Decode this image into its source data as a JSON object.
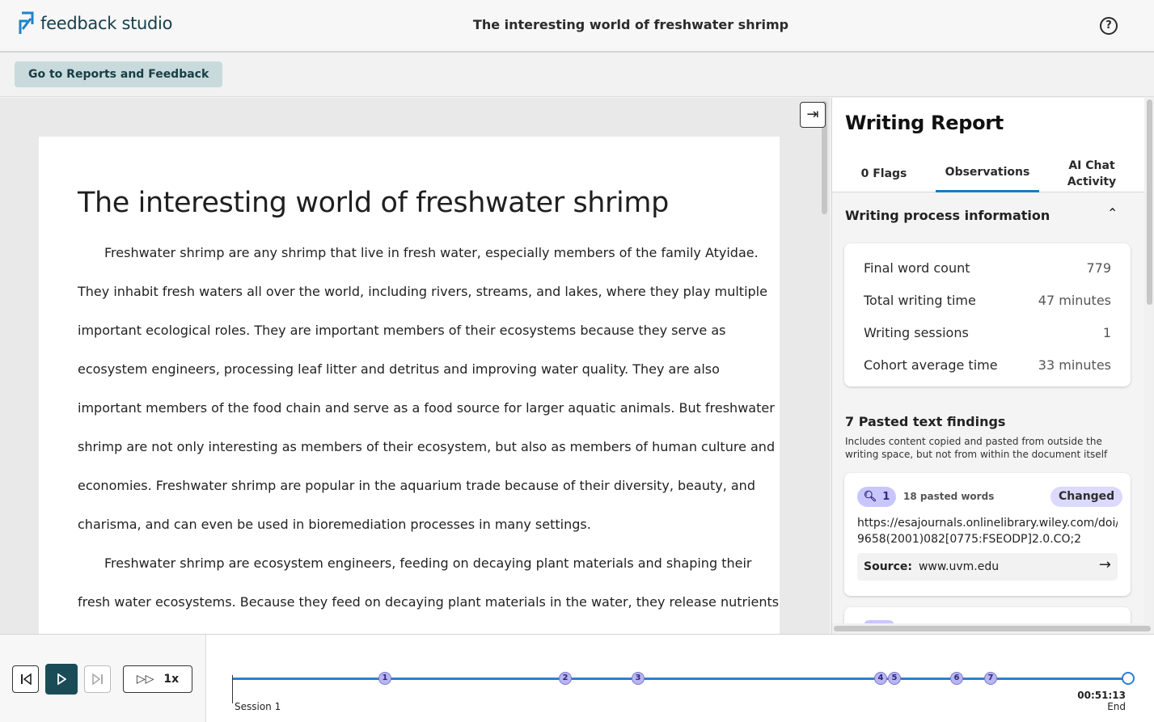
{
  "header": {
    "brand": "feedback studio",
    "document_title": "The interesting world of freshwater shrimp",
    "help_icon": "question-circle-icon"
  },
  "subbar": {
    "reports_button": "Go to Reports and Feedback"
  },
  "essay": {
    "title": "The interesting world of freshwater shrimp",
    "lines": [
      "Freshwater shrimp are any shrimp that live in fresh water, especially members of the family Atyidae.",
      "They inhabit fresh waters all over the world, including rivers, streams, and lakes, where they play multiple",
      "important ecological roles. They are important members of their ecosystems because they serve as",
      "ecosystem engineers, processing leaf litter and detritus and improving water quality. They are also",
      "important members of the food chain and serve as a food source for larger aquatic animals. But freshwater",
      "shrimp are not only interesting as members of their ecosystem, but also as members of human culture and",
      "economies. Freshwater shrimp are popular in the aquarium trade because of their diversity, beauty, and",
      "charisma, and can even be used in bioremediation processes in many settings.",
      "Freshwater shrimp are ecosystem engineers, feeding on decaying plant materials and shaping their",
      "fresh water ecosystems. Because they feed on decaying plant materials in the water, they release nutrients"
    ]
  },
  "panel": {
    "title": "Writing Report",
    "tabs": [
      {
        "label": "0 Flags",
        "selected": false
      },
      {
        "label": "Observations",
        "selected": true
      },
      {
        "label": "AI Chat Activity",
        "selected": false
      }
    ],
    "section_title": "Writing process information",
    "stats": [
      {
        "label": "Final word count",
        "value": "779"
      },
      {
        "label": "Total writing time",
        "value": "47 minutes"
      },
      {
        "label": "Writing sessions",
        "value": "1"
      },
      {
        "label": "Cohort average time",
        "value": "33 minutes"
      }
    ],
    "pasted_title": "7 Pasted text findings",
    "pasted_desc": "Includes content copied and pasted from outside the writing space, but not from within the document itself",
    "finding": {
      "number": "1",
      "words": "18 pasted words",
      "status": "Changed",
      "url_line1": "https://esajournals.onlinelibrary.wiley.com/doi/al",
      "url_line2": "9658(2001)082[0775:FSEODP]2.0.CO;2",
      "source_label": "Source:",
      "source_value": "www.uvm.edu"
    }
  },
  "playback": {
    "speed": "1x",
    "session_label": "Session 1",
    "end_time": "00:51:13",
    "end_label": "End",
    "markers": [
      "1",
      "2",
      "3",
      "4",
      "5",
      "6",
      "7"
    ],
    "accent": "#2d7fcf",
    "play_color": "#1a4c57"
  }
}
